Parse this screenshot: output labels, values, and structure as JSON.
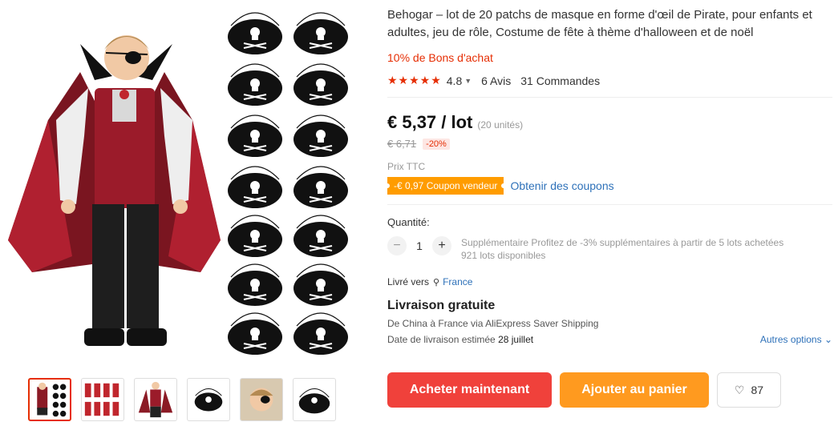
{
  "product": {
    "title": "Behogar – lot de 20 patchs de masque en forme d'œil de Pirate, pour enfants et adultes, jeu de rôle, Costume de fête à thème d'halloween et de noël",
    "bons": "10% de Bons d'achat",
    "rating": "4.8",
    "reviews": "6 Avis",
    "orders": "31 Commandes"
  },
  "price": {
    "current": "€ 5,37 / lot",
    "units": "(20 unités)",
    "old": "€ 6,71",
    "discount": "-20%",
    "ttc": "Prix TTC",
    "coupon": "-€ 0,97 Coupon vendeur",
    "coupon_link": "Obtenir des coupons"
  },
  "quantity": {
    "label": "Quantité:",
    "value": "1",
    "minus": "−",
    "plus": "+",
    "promo": "Supplémentaire Profitez de -3% supplémentaires à partir de 5 lots achetées",
    "stock": "921 lots disponibles"
  },
  "shipping": {
    "ship_to_label": "Livré vers",
    "country": "France",
    "free": "Livraison gratuite",
    "via": "De China à France via AliExpress Saver Shipping",
    "date_label": "Date de livraison estimée",
    "date": "28 juillet",
    "more_options": "Autres options"
  },
  "actions": {
    "buy": "Acheter maintenant",
    "cart": "Ajouter au panier",
    "wish_count": "87"
  },
  "icons": {
    "star": "star-icon",
    "chevron": "chevron-down-icon",
    "pin": "location-pin-icon",
    "heart": "heart-icon"
  },
  "colors": {
    "accent": "#e62e04",
    "buy": "#f0413b",
    "cart": "#ff9a1f",
    "coupon": "#ff9c00",
    "link": "#2e71b9"
  }
}
